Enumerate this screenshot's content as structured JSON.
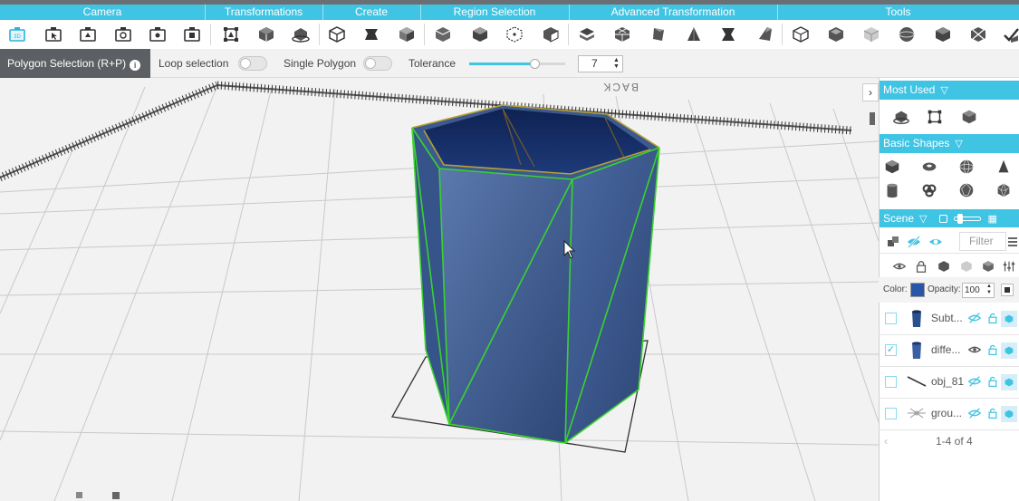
{
  "toolbar": {
    "categories": [
      "Camera",
      "Transformations",
      "Create",
      "Region Selection",
      "Advanced Transformation",
      "Tools"
    ],
    "camera_icons": [
      "camera-3d-icon",
      "camera-pan-icon",
      "camera-rotate-icon",
      "camera-orbit-icon",
      "camera-zoom-icon",
      "camera-fit-icon"
    ],
    "transform_icons": [
      "scale-icon",
      "move-icon",
      "rotate-icon"
    ],
    "create_icons": [
      "extrude-icon",
      "bevel-icon",
      "inset-icon"
    ],
    "region_icons": [
      "region-box-icon",
      "region-face-icon",
      "region-vertex-icon",
      "region-edge-icon"
    ],
    "advanced_icons": [
      "advanced-stack-icon",
      "advanced-subdivide-icon",
      "advanced-taper-icon",
      "advanced-cone-icon",
      "advanced-twist-icon",
      "advanced-bend-icon"
    ],
    "tools_icons": [
      "tool-measure-icon",
      "tool-hollow-icon",
      "tool-wire-icon",
      "tool-sphere-icon",
      "tool-cube-icon",
      "tool-split-icon",
      "tool-check-icon"
    ]
  },
  "options": {
    "mode_label": "Polygon Selection (R+P)",
    "loop_selection_label": "Loop selection",
    "single_polygon_label": "Single Polygon",
    "tolerance_label": "Tolerance",
    "tolerance_value": "7",
    "tolerance_slider_fraction": 0.68
  },
  "viewport": {
    "back_label": "BACK",
    "object_color": "#3b5a8c"
  },
  "panel": {
    "most_used_label": "Most Used",
    "basic_shapes_label": "Basic Shapes",
    "scene_label": "Scene",
    "filter_placeholder": "Filter",
    "color_label": "Color:",
    "opacity_label": "Opacity:",
    "opacity_value": "100",
    "color_swatch": "#2a56a8",
    "items": [
      {
        "name": "Subt...",
        "checked": false
      },
      {
        "name": "diffe...",
        "checked": true
      },
      {
        "name": "obj_81",
        "checked": false
      },
      {
        "name": "grou...",
        "checked": false
      }
    ],
    "pagination": "1-4 of 4"
  },
  "colors": {
    "accent": "#40c4e4",
    "selection_edge": "#37d433"
  }
}
